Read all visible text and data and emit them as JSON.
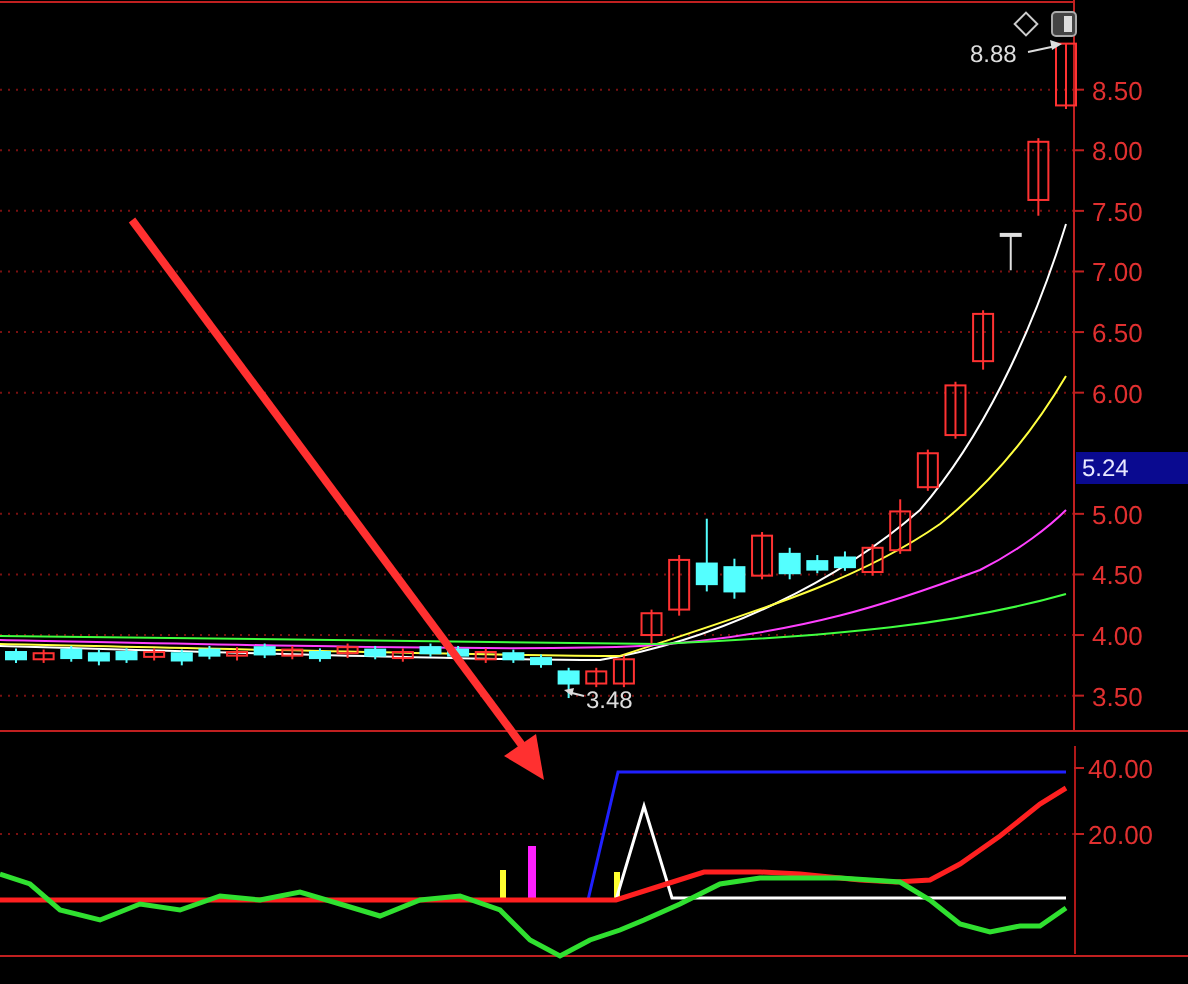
{
  "price_chart": {
    "chart_data": {
      "type": "candlestick",
      "categories": [
        null,
        null,
        null,
        null,
        null,
        null,
        null,
        null,
        null,
        null,
        null,
        null,
        null,
        null,
        null,
        null,
        null,
        null,
        null,
        null,
        null,
        null,
        null,
        null,
        null,
        null,
        null,
        null,
        null,
        null,
        null,
        null,
        null,
        null,
        null,
        null,
        null,
        null,
        null
      ],
      "ohlc": [
        [
          3.86,
          3.89,
          3.77,
          3.8
        ],
        [
          3.8,
          3.88,
          3.77,
          3.85
        ],
        [
          3.88,
          3.91,
          3.78,
          3.81
        ],
        [
          3.85,
          3.88,
          3.75,
          3.79
        ],
        [
          3.86,
          3.89,
          3.77,
          3.8
        ],
        [
          3.82,
          3.89,
          3.79,
          3.86
        ],
        [
          3.85,
          3.88,
          3.75,
          3.79
        ],
        [
          3.88,
          3.91,
          3.8,
          3.83
        ],
        [
          3.83,
          3.9,
          3.79,
          3.86
        ],
        [
          3.9,
          3.93,
          3.81,
          3.84
        ],
        [
          3.83,
          3.91,
          3.8,
          3.88
        ],
        [
          3.86,
          3.89,
          3.78,
          3.81
        ],
        [
          3.85,
          3.93,
          3.81,
          3.9
        ],
        [
          3.88,
          3.91,
          3.8,
          3.83
        ],
        [
          3.81,
          3.89,
          3.78,
          3.86
        ],
        [
          3.9,
          3.93,
          3.82,
          3.85
        ],
        [
          3.88,
          3.91,
          3.8,
          3.83
        ],
        [
          3.8,
          3.89,
          3.77,
          3.86
        ],
        [
          3.85,
          3.88,
          3.77,
          3.8
        ],
        [
          3.81,
          3.84,
          3.73,
          3.76
        ],
        [
          3.7,
          3.73,
          3.48,
          3.6
        ],
        [
          3.6,
          3.73,
          3.57,
          3.7
        ],
        [
          3.6,
          3.83,
          3.57,
          3.8
        ],
        [
          4.0,
          4.21,
          3.93,
          4.18
        ],
        [
          4.21,
          4.66,
          4.16,
          4.62
        ],
        [
          4.59,
          4.96,
          4.36,
          4.42
        ],
        [
          4.56,
          4.63,
          4.3,
          4.36
        ],
        [
          4.49,
          4.85,
          4.46,
          4.82
        ],
        [
          4.67,
          4.72,
          4.46,
          4.51
        ],
        [
          4.61,
          4.66,
          4.51,
          4.54
        ],
        [
          4.64,
          4.69,
          4.53,
          4.56
        ],
        [
          4.52,
          4.75,
          4.49,
          4.72
        ],
        [
          4.7,
          5.12,
          4.67,
          5.02
        ],
        [
          5.22,
          5.53,
          5.19,
          5.5
        ],
        [
          5.65,
          6.09,
          5.62,
          6.06
        ],
        [
          6.26,
          6.68,
          6.19,
          6.65
        ],
        [
          7.31,
          7.31,
          7.01,
          7.31
        ],
        [
          7.59,
          8.1,
          7.46,
          8.07
        ],
        [
          8.37,
          8.88,
          8.34,
          8.88
        ]
      ],
      "ylim": [
        3.2,
        9.24
      ],
      "grid": true,
      "yticks": [
        {
          "value": 8.5,
          "label": "8.50"
        },
        {
          "value": 8,
          "label": "8.00"
        },
        {
          "value": 7.5,
          "label": "7.50"
        },
        {
          "value": 7,
          "label": "7.00"
        },
        {
          "value": 6.5,
          "label": "6.50"
        },
        {
          "value": 6,
          "label": "6.00"
        },
        {
          "value": 5,
          "label": "5.00"
        },
        {
          "value": 4.5,
          "label": "4.50"
        },
        {
          "value": 4,
          "label": "4.00"
        },
        {
          "value": 3.5,
          "label": "3.50"
        }
      ]
    }
  },
  "current_price": "5.24",
  "high_label": "8.88",
  "low_label": "3.48",
  "indicator_axis": {
    "ticks": [
      "40.00",
      "20.00"
    ]
  }
}
